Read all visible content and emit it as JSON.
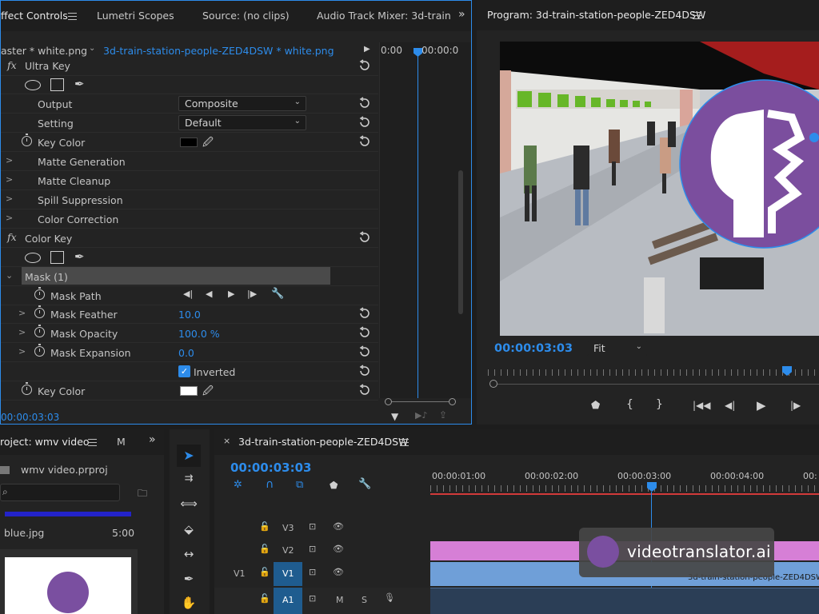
{
  "effect_controls": {
    "tabs": [
      "ffect Controls",
      "Lumetri Scopes",
      "Source: (no clips)",
      "Audio Track Mixer: 3d-train"
    ],
    "master_label": "aster * white.png",
    "clip_label": "3d-train-station-people-ZED4DSW * white.png",
    "ruler_start": "0:00",
    "ruler_head": "00:00:0",
    "fx1_name": "Ultra Key",
    "output_label": "Output",
    "output_value": "Composite",
    "setting_label": "Setting",
    "setting_value": "Default",
    "key_color_label": "Key Color",
    "matte_generation": "Matte Generation",
    "matte_cleanup": "Matte Cleanup",
    "spill_suppression": "Spill Suppression",
    "color_correction": "Color Correction",
    "fx2_name": "Color Key",
    "mask_label": "Mask (1)",
    "mask_path": "Mask Path",
    "mask_feather_label": "Mask Feather",
    "mask_feather_value": "10.0",
    "mask_opacity_label": "Mask Opacity",
    "mask_opacity_value": "100.0 %",
    "mask_expansion_label": "Mask Expansion",
    "mask_expansion_value": "0.0",
    "inverted_label": "Inverted",
    "key_color2_label": "Key Color",
    "timecode": "00:00:03:03",
    "fx_glyph": "fx"
  },
  "program": {
    "title": "Program: 3d-train-station-people-ZED4DSW",
    "timecode": "00:00:03:03",
    "zoom": "Fit"
  },
  "project": {
    "tab": "roject: wmv video",
    "tab2": "M",
    "file": "wmv video.prproj",
    "item_name": "blue.jpg",
    "item_duration": "5:00"
  },
  "timeline": {
    "tab": "3d-train-station-people-ZED4DSW",
    "timecode": "00:00:03:03",
    "ruler": [
      "00:00:01:00",
      "00:00:02:00",
      "00:00:03:00",
      "00:00:04:00",
      "00:"
    ],
    "tracks": [
      "V3",
      "V2",
      "V1",
      "A1"
    ],
    "source_patch": "V1",
    "clip_name": "3d-train-station-people-ZED4DSW",
    "audio_m": "M",
    "audio_s": "S"
  },
  "watermark": {
    "text": "videotranslator.ai"
  },
  "colors": {
    "accent": "#2d8ceb",
    "brand_purple": "#7a4fa0",
    "clip_pink": "#d67fd6",
    "clip_blue": "#6f9fd8"
  }
}
